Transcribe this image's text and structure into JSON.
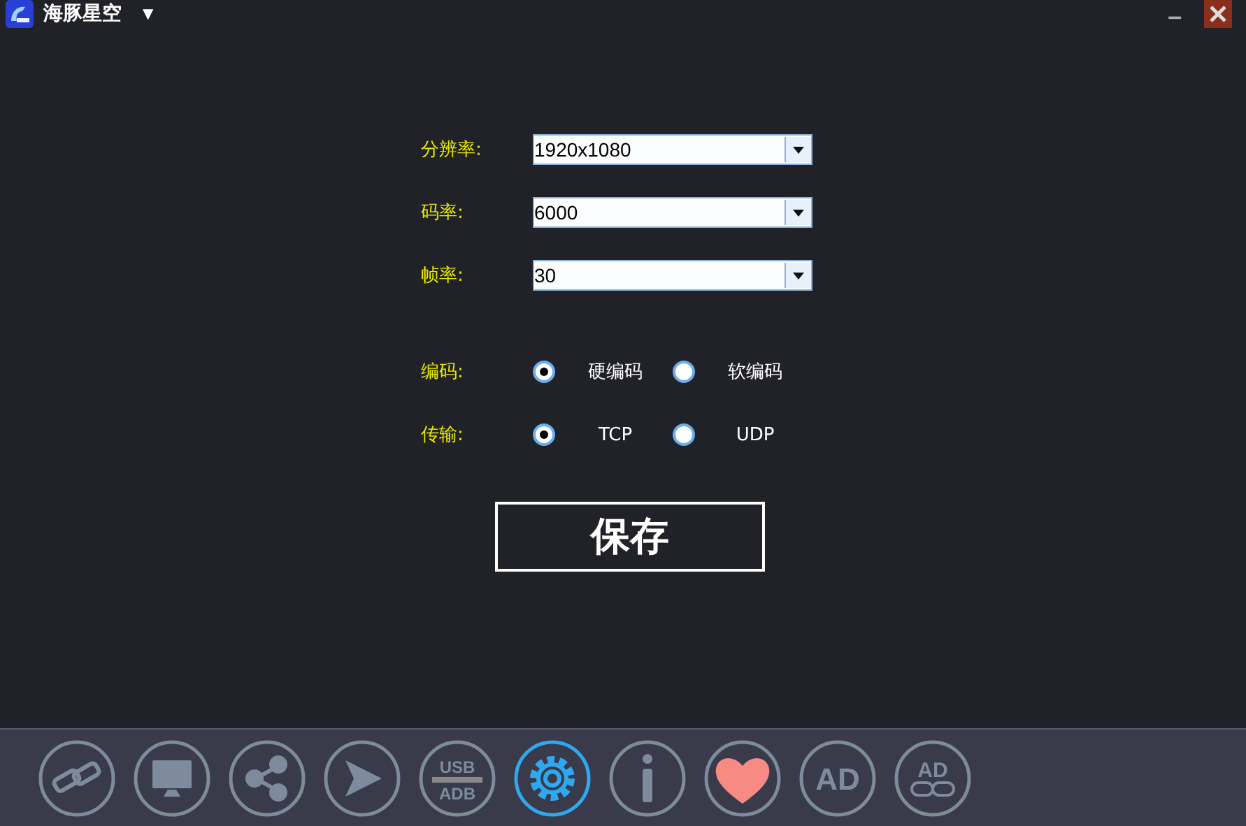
{
  "window": {
    "title": "海豚星空",
    "menu_caret": "▼"
  },
  "settings": [
    {
      "label": "分辨率:",
      "value": "1920x1080"
    },
    {
      "label": "码率:",
      "value": "6000"
    },
    {
      "label": "帧率:",
      "value": "30"
    }
  ],
  "options": [
    {
      "label": "编码:",
      "choices": [
        {
          "text": "硬编码",
          "selected": true
        },
        {
          "text": "软编码",
          "selected": false
        }
      ]
    },
    {
      "label": "传输:",
      "choices": [
        {
          "text": "TCP",
          "selected": true
        },
        {
          "text": "UDP",
          "selected": false
        }
      ]
    }
  ],
  "save_button": "保存",
  "toolbar": [
    {
      "kind": "link",
      "selected": false
    },
    {
      "kind": "monitor",
      "selected": false
    },
    {
      "kind": "share",
      "selected": false
    },
    {
      "kind": "play",
      "selected": false
    },
    {
      "kind": "usb",
      "selected": false,
      "top": "USB",
      "bottom": "ADB"
    },
    {
      "kind": "settings",
      "selected": true
    },
    {
      "kind": "info",
      "selected": false
    },
    {
      "kind": "heart",
      "selected": false
    },
    {
      "kind": "ad",
      "selected": false,
      "text": "AD"
    },
    {
      "kind": "adlink",
      "selected": false,
      "text": "AD"
    }
  ]
}
